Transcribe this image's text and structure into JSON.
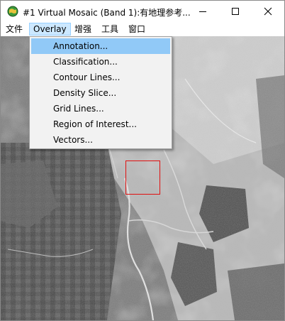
{
  "window": {
    "title": "#1 Virtual Mosaic (Band 1):有地理参考...",
    "controls": {
      "minimize": "minimize",
      "maximize": "maximize",
      "close": "close"
    }
  },
  "menubar": {
    "items": [
      {
        "label": "文件"
      },
      {
        "label": "Overlay",
        "active": true
      },
      {
        "label": "增强"
      },
      {
        "label": "工具"
      },
      {
        "label": "窗口"
      }
    ]
  },
  "overlay_menu": {
    "items": [
      {
        "label": "Annotation...",
        "highlighted": true
      },
      {
        "label": "Classification..."
      },
      {
        "label": "Contour Lines..."
      },
      {
        "label": "Density Slice..."
      },
      {
        "label": "Grid Lines..."
      },
      {
        "label": "Region of Interest..."
      },
      {
        "label": "Vectors..."
      }
    ]
  },
  "colors": {
    "menu_highlight": "#91c9f7",
    "active_menu_bg": "#cce8ff",
    "zoom_box": "#e01010"
  },
  "icons": {
    "app": "envi-globe-icon",
    "minimize": "minimize-icon",
    "maximize": "maximize-icon",
    "close": "close-icon"
  }
}
